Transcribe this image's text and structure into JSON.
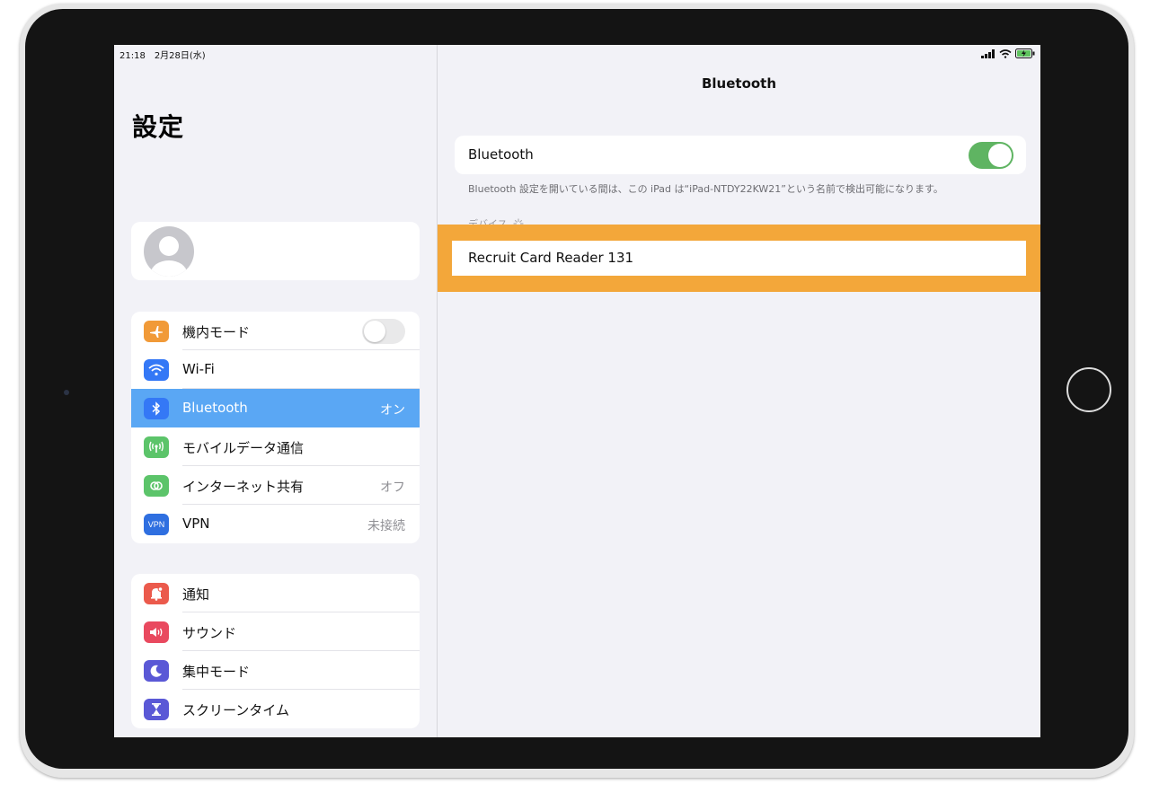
{
  "status_bar": {
    "time": "21:18　2月28日(水)"
  },
  "sidebar": {
    "title": "設定",
    "group1": [
      {
        "label": "機内モード",
        "value": "",
        "icon": "airplane-icon",
        "color": "#f19a38"
      },
      {
        "label": "Wi-Fi",
        "value": "",
        "icon": "wifi-icon",
        "color": "#3478f6"
      },
      {
        "label": "Bluetooth",
        "value": "オン",
        "icon": "bluetooth-icon",
        "color": "#3478f6"
      },
      {
        "label": "モバイルデータ通信",
        "value": "",
        "icon": "antenna-icon",
        "color": "#5cc46a"
      },
      {
        "label": "インターネット共有",
        "value": "オフ",
        "icon": "link-icon",
        "color": "#5cc46a"
      },
      {
        "label": "VPN",
        "value": "未接続",
        "icon": "vpn-icon",
        "icon_text": "VPN",
        "color": "#2f6fe0"
      }
    ],
    "group2": [
      {
        "label": "通知",
        "icon": "bell-icon",
        "color": "#eb5a4c"
      },
      {
        "label": "サウンド",
        "icon": "speaker-icon",
        "color": "#e9495f"
      },
      {
        "label": "集中モード",
        "icon": "moon-icon",
        "color": "#5a58d6"
      },
      {
        "label": "スクリーンタイム",
        "icon": "hourglass-icon",
        "color": "#5a58d6"
      }
    ]
  },
  "detail": {
    "nav_title": "Bluetooth",
    "bluetooth_label": "Bluetooth",
    "footnote": "Bluetooth 設定を開いている間は、この iPad は“iPad-NTDY22KW21”という名前で検出可能になります。",
    "devices_header": "デバイス",
    "device_name": "Recruit Card Reader 131"
  },
  "colors": {
    "highlight": "#f3a73a",
    "selected_row": "#5aa7f4",
    "toggle_on": "#5fb462"
  }
}
